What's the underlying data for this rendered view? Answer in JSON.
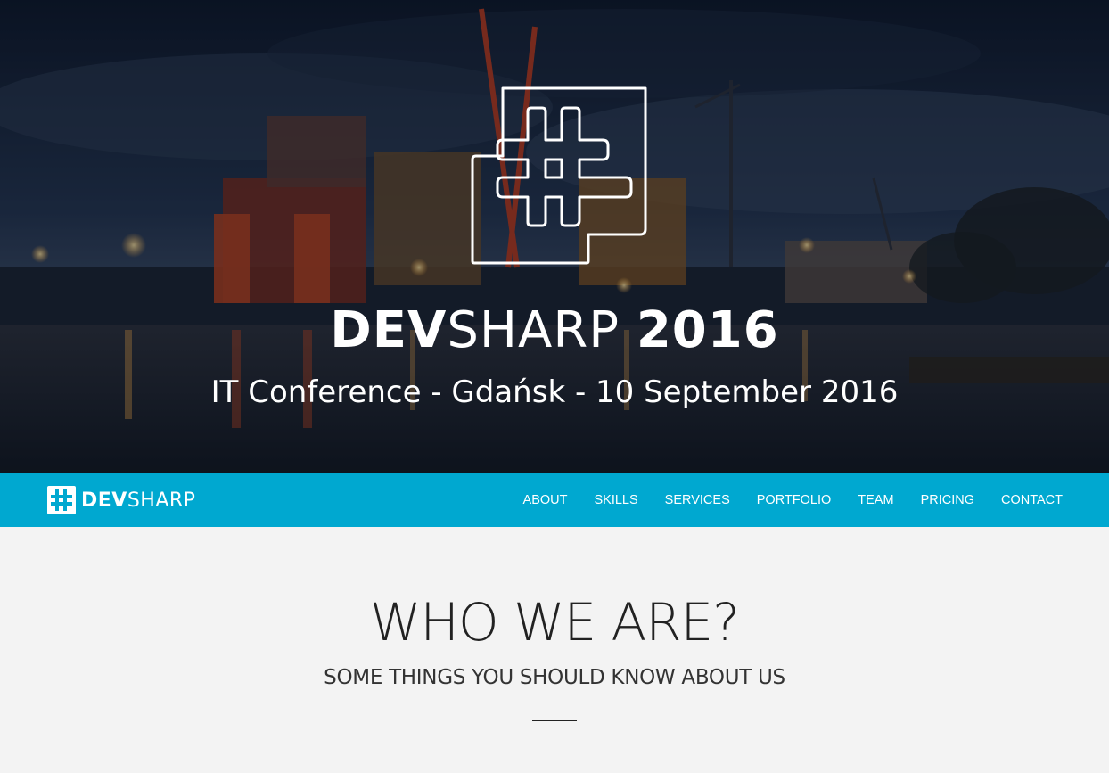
{
  "hero": {
    "title_bold_1": "DEV",
    "title_light": "SHARP",
    "title_bold_2": "2016",
    "subtitle": "IT Conference - Gdańsk - 10 September 2016",
    "logo_icon": "puzzle-hash-icon"
  },
  "navbar": {
    "brand_bold": "DEV",
    "brand_light": "SHARP",
    "brand_icon": "puzzle-hash-icon",
    "items": [
      {
        "label": "ABOUT"
      },
      {
        "label": "SKILLS"
      },
      {
        "label": "SERVICES"
      },
      {
        "label": "PORTFOLIO"
      },
      {
        "label": "TEAM"
      },
      {
        "label": "PRICING"
      },
      {
        "label": "CONTACT"
      }
    ],
    "background_color": "#00a8d0"
  },
  "about": {
    "title": "WHO WE ARE?",
    "subtitle": "SOME THINGS YOU SHOULD KNOW ABOUT US"
  }
}
